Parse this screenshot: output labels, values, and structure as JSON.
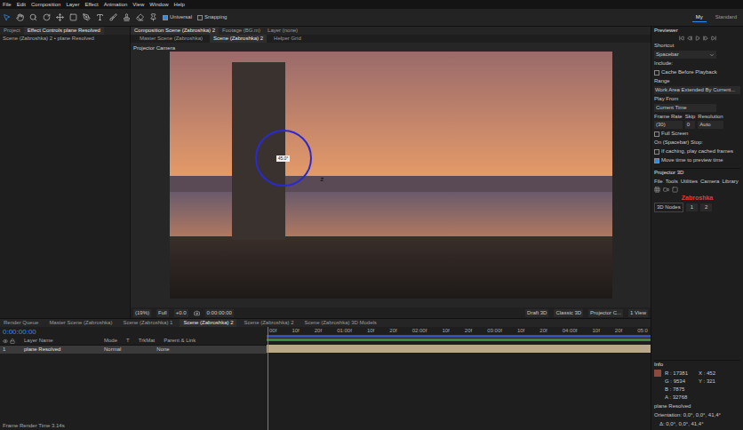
{
  "menu": [
    "File",
    "Edit",
    "Composition",
    "Layer",
    "Effect",
    "Animation",
    "View",
    "Window",
    "Help"
  ],
  "toolbar": {
    "options": [
      {
        "label": "Universal",
        "checked": true
      },
      {
        "label": "Snapping",
        "checked": false
      }
    ],
    "workspaces": [
      {
        "label": "My",
        "selected": true
      },
      {
        "label": "Standard",
        "selected": false
      }
    ]
  },
  "left_panel": {
    "tabs": [
      {
        "label": "Project",
        "selected": false
      },
      {
        "label": "Effect Controls plane Resolved",
        "selected": true
      }
    ],
    "subtitle": "Scene (Zabroshka) 2 • plane Resolved"
  },
  "composition": {
    "tabs": [
      {
        "label": "Composition Scene (Zabroshka) 2",
        "selected": true
      },
      {
        "label": "Footage (BG.m)",
        "selected": false
      },
      {
        "label": "Layer (none)",
        "selected": false
      }
    ],
    "subtabs": [
      {
        "label": "Master Scene (Zabroshka)",
        "selected": false
      },
      {
        "label": "Scene (Zabroshka) 2",
        "selected": true
      },
      {
        "label": "Helper Grid",
        "selected": false
      }
    ],
    "camera_label": "Projector Camera",
    "gizmo_label": "45.0°",
    "axis_label": "Z",
    "viewer_bar": [
      "(19%)",
      "Full",
      "+0.0",
      "0:00:00:00",
      "Draft 3D",
      "Classic 3D",
      "Projector C...",
      "1 View"
    ]
  },
  "previewer": {
    "title": "Previewer",
    "shortcut_label": "Shortcut",
    "shortcut": "Spacebar",
    "include_label": "Include:",
    "checks": [
      {
        "label": "Cache Before Playback",
        "checked": false
      }
    ],
    "range_label": "Range",
    "range": "Work Area Extended By Current...",
    "play_from_label": "Play From",
    "play_from": "Current Time",
    "columns": [
      {
        "label": "Frame Rate",
        "value": "(30)"
      },
      {
        "label": "Skip",
        "value": "0"
      },
      {
        "label": "Resolution",
        "value": "Auto"
      }
    ],
    "full_screen": {
      "label": "Full Screen",
      "checked": false
    },
    "stop_label": "On (Spacebar) Stop:",
    "stop_checks": [
      {
        "label": "If caching, play cached frames",
        "checked": false
      },
      {
        "label": "Move time to preview time",
        "checked": true
      }
    ]
  },
  "projector": {
    "title": "Projector 3D",
    "menu": [
      "File",
      "Tools",
      "Utilities",
      "Camera",
      "Library"
    ],
    "project": "Zabroshka",
    "nodes_button": "3D Nodes",
    "fields": [
      "1",
      "2"
    ]
  },
  "info": {
    "title": "Info",
    "rgba": [
      "R : 17381",
      "G : 9534",
      "B : 7875",
      "A : 32768"
    ],
    "xy": [
      "X : 452",
      "Y : 321"
    ],
    "color": "#8a4a3e",
    "layer": "plane Resolved",
    "orientation": "Orientation: 0,0°, 0,0°, 41,4°",
    "delta": "Δ: 0,0°, 0,0°, 41,4°"
  },
  "timeline": {
    "tabs": [
      {
        "label": "Render Queue",
        "selected": false
      },
      {
        "label": "Master Scene (Zabroshka)",
        "selected": false
      },
      {
        "label": "Scene (Zabroshka) 1",
        "selected": false
      },
      {
        "label": "Scene (Zabroshka) 2",
        "selected": true
      },
      {
        "label": "Scene (Zabroshka) 2",
        "selected": false
      },
      {
        "label": "Scene (Zabroshka) 3D Models",
        "selected": false
      }
    ],
    "timecode": "0:00:00:00",
    "columns": [
      "Layer Name",
      "Mode",
      "T",
      "TrkMat",
      "Parent & Link"
    ],
    "rows": [
      {
        "index": "1",
        "name": "plane Resolved",
        "mode": "Normal",
        "parent": "None",
        "selected": true
      }
    ],
    "ruler": [
      "00f",
      "10f",
      "20f",
      "01:00f",
      "10f",
      "20f",
      "02:00f",
      "10f",
      "20f",
      "03:00f",
      "10f",
      "20f",
      "04:00f",
      "10f",
      "20f",
      "05:0"
    ],
    "footer": "Frame Render Time 3.14s"
  }
}
